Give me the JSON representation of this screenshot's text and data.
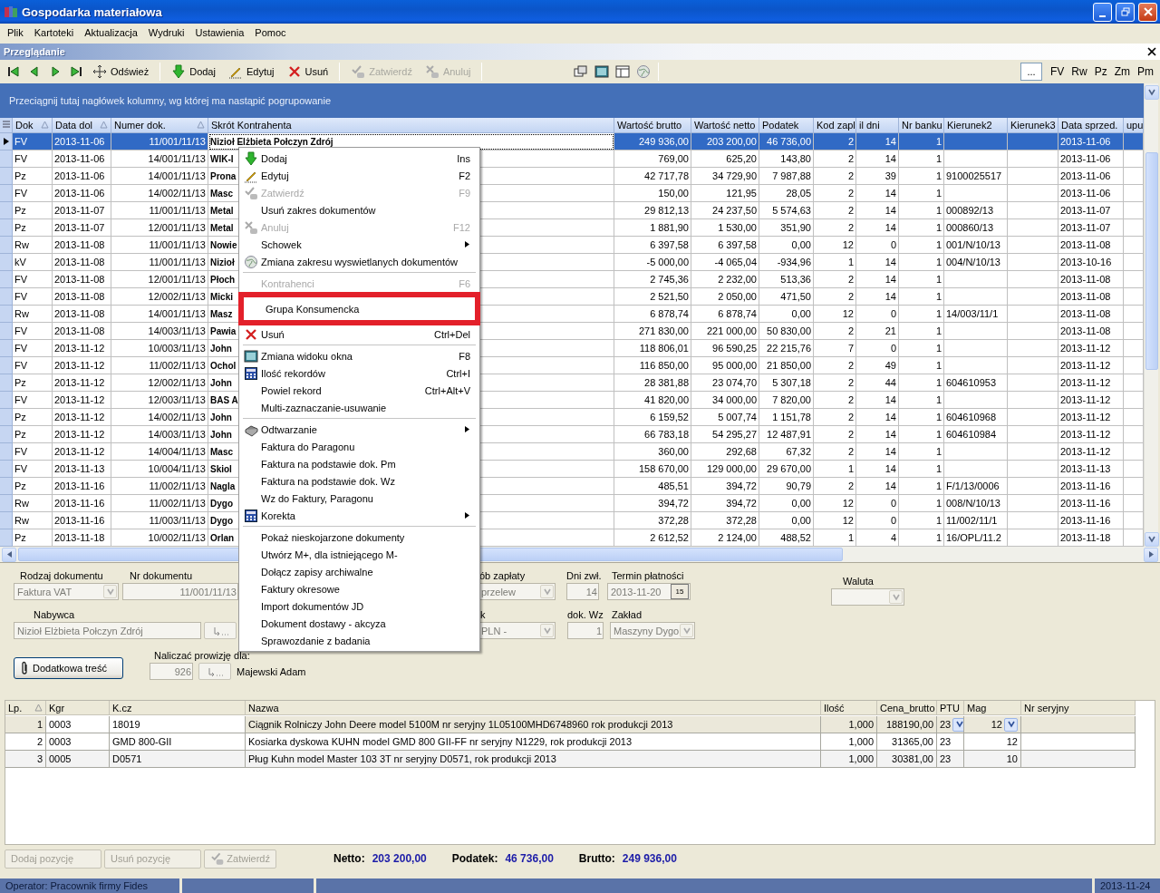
{
  "window": {
    "title": "Gospodarka materiałowa"
  },
  "menu_bar": [
    "Plik",
    "Kartoteki",
    "Aktualizacja",
    "Wydruki",
    "Ustawienia",
    "Pomoc"
  ],
  "panel": {
    "title": "Przeglądanie"
  },
  "toolbar": {
    "buttons": [
      {
        "label": "Odśwież",
        "disabled": false
      },
      {
        "label": "Dodaj",
        "disabled": false
      },
      {
        "label": "Edytuj",
        "disabled": false
      },
      {
        "label": "Usuń",
        "disabled": false
      },
      {
        "label": "Zatwierdź",
        "disabled": true
      },
      {
        "label": "Anuluj",
        "disabled": true
      }
    ],
    "more_button": "...",
    "filters": [
      "FV",
      "Rw",
      "Pz",
      "Zm",
      "Pm"
    ]
  },
  "grid": {
    "group_hint": "Przeciągnij tutaj nagłówek kolumny, wg której ma nastąpić pogrupowanie",
    "columns": [
      {
        "label": "Dok",
        "sorted": true
      },
      {
        "label": "Data dol",
        "sorted": true
      },
      {
        "label": "Numer dok.",
        "sorted": true
      },
      {
        "label": "Skrót Kontrahenta",
        "sorted": false
      },
      {
        "label": "Wartość brutto",
        "sorted": false
      },
      {
        "label": "Wartość netto",
        "sorted": false
      },
      {
        "label": "Podatek",
        "sorted": false
      },
      {
        "label": "Kod zapl",
        "sorted": false
      },
      {
        "label": "il dni",
        "sorted": false
      },
      {
        "label": "Nr banku",
        "sorted": false
      },
      {
        "label": "Kierunek2",
        "sorted": false
      },
      {
        "label": "Kierunek3",
        "sorted": false
      },
      {
        "label": "Data sprzed.",
        "sorted": false
      },
      {
        "label": "upu",
        "sorted": false
      }
    ],
    "rows": [
      {
        "selected": true,
        "cells": [
          "FV",
          "2013-11-06",
          "11/001/11/13",
          "Nizioł Elżbieta Połczyn Zdrój",
          "249 936,00",
          "203 200,00",
          "46 736,00",
          "2",
          "14",
          "1",
          null,
          null,
          "2013-11-06"
        ]
      },
      {
        "selected": false,
        "cells": [
          "FV",
          "2013-11-06",
          "14/001/11/13",
          "WIK-I",
          "769,00",
          "625,20",
          "143,80",
          "2",
          "14",
          "1",
          null,
          null,
          "2013-11-06"
        ]
      },
      {
        "selected": false,
        "cells": [
          "Pz",
          "2013-11-06",
          "14/001/11/13",
          "Prona",
          "42 717,78",
          "34 729,90",
          "7 987,88",
          "2",
          "39",
          "1",
          "9100025517",
          null,
          "2013-11-06"
        ]
      },
      {
        "selected": false,
        "cells": [
          "FV",
          "2013-11-06",
          "14/002/11/13",
          "Masc",
          "150,00",
          "121,95",
          "28,05",
          "2",
          "14",
          "1",
          null,
          null,
          "2013-11-06"
        ]
      },
      {
        "selected": false,
        "cells": [
          "Pz",
          "2013-11-07",
          "11/001/11/13",
          "Metal",
          "29 812,13",
          "24 237,50",
          "5 574,63",
          "2",
          "14",
          "1",
          "000892/13",
          null,
          "2013-11-07"
        ]
      },
      {
        "selected": false,
        "cells": [
          "Pz",
          "2013-11-07",
          "12/001/11/13",
          "Metal",
          "1 881,90",
          "1 530,00",
          "351,90",
          "2",
          "14",
          "1",
          "000860/13",
          null,
          "2013-11-07"
        ]
      },
      {
        "selected": false,
        "cells": [
          "Rw",
          "2013-11-08",
          "11/001/11/13",
          "Nowie",
          "6 397,58",
          "6 397,58",
          "0,00",
          "12",
          "0",
          "1",
          "001/N/10/13",
          null,
          "2013-11-08"
        ]
      },
      {
        "selected": false,
        "cells": [
          "kV",
          "2013-11-08",
          "11/001/11/13",
          "Nizioł",
          "-5 000,00",
          "-4 065,04",
          "-934,96",
          "1",
          "14",
          "1",
          "004/N/10/13",
          null,
          "2013-10-16"
        ]
      },
      {
        "selected": false,
        "cells": [
          "FV",
          "2013-11-08",
          "12/001/11/13",
          "Płoch",
          "2 745,36",
          "2 232,00",
          "513,36",
          "2",
          "14",
          "1",
          null,
          null,
          "2013-11-08"
        ]
      },
      {
        "selected": false,
        "cells": [
          "FV",
          "2013-11-08",
          "12/002/11/13",
          "Micki",
          "2 521,50",
          "2 050,00",
          "471,50",
          "2",
          "14",
          "1",
          null,
          null,
          "2013-11-08"
        ]
      },
      {
        "selected": false,
        "cells": [
          "Rw",
          "2013-11-08",
          "14/001/11/13",
          "Masz",
          "6 878,74",
          "6 878,74",
          "0,00",
          "12",
          "0",
          "1",
          "14/003/11/1",
          null,
          "2013-11-08"
        ]
      },
      {
        "selected": false,
        "cells": [
          "FV",
          "2013-11-08",
          "14/003/11/13",
          "Pawia",
          "271 830,00",
          "221 000,00",
          "50 830,00",
          "2",
          "21",
          "1",
          null,
          null,
          "2013-11-08"
        ]
      },
      {
        "selected": false,
        "cells": [
          "FV",
          "2013-11-12",
          "10/003/11/13",
          "John",
          "118 806,01",
          "96 590,25",
          "22 215,76",
          "7",
          "0",
          "1",
          null,
          null,
          "2013-11-12"
        ]
      },
      {
        "selected": false,
        "cells": [
          "FV",
          "2013-11-12",
          "11/002/11/13",
          "Ochol",
          "116 850,00",
          "95 000,00",
          "21 850,00",
          "2",
          "49",
          "1",
          null,
          null,
          "2013-11-12"
        ]
      },
      {
        "selected": false,
        "cells": [
          "Pz",
          "2013-11-12",
          "12/002/11/13",
          "John",
          "28 381,88",
          "23 074,70",
          "5 307,18",
          "2",
          "44",
          "1",
          "604610953",
          null,
          "2013-11-12"
        ]
      },
      {
        "selected": false,
        "cells": [
          "FV",
          "2013-11-12",
          "12/003/11/13",
          "BAS A",
          "41 820,00",
          "34 000,00",
          "7 820,00",
          "2",
          "14",
          "1",
          null,
          null,
          "2013-11-12"
        ]
      },
      {
        "selected": false,
        "cells": [
          "Pz",
          "2013-11-12",
          "14/002/11/13",
          "John",
          "6 159,52",
          "5 007,74",
          "1 151,78",
          "2",
          "14",
          "1",
          "604610968",
          null,
          "2013-11-12"
        ]
      },
      {
        "selected": false,
        "cells": [
          "Pz",
          "2013-11-12",
          "14/003/11/13",
          "John",
          "66 783,18",
          "54 295,27",
          "12 487,91",
          "2",
          "14",
          "1",
          "604610984",
          null,
          "2013-11-12"
        ]
      },
      {
        "selected": false,
        "cells": [
          "FV",
          "2013-11-12",
          "14/004/11/13",
          "Masc",
          "360,00",
          "292,68",
          "67,32",
          "2",
          "14",
          "1",
          null,
          null,
          "2013-11-12"
        ]
      },
      {
        "selected": false,
        "cells": [
          "FV",
          "2013-11-13",
          "10/004/11/13",
          "Skiol",
          "158 670,00",
          "129 000,00",
          "29 670,00",
          "1",
          "14",
          "1",
          null,
          null,
          "2013-11-13"
        ]
      },
      {
        "selected": false,
        "cells": [
          "Pz",
          "2013-11-16",
          "11/002/11/13",
          "Nagla",
          "485,51",
          "394,72",
          "90,79",
          "2",
          "14",
          "1",
          "F/1/13/0006",
          null,
          "2013-11-16"
        ]
      },
      {
        "selected": false,
        "cells": [
          "Rw",
          "2013-11-16",
          "11/002/11/13",
          "Dygo",
          "394,72",
          "394,72",
          "0,00",
          "12",
          "0",
          "1",
          "008/N/10/13",
          null,
          "2013-11-16"
        ]
      },
      {
        "selected": false,
        "cells": [
          "Rw",
          "2013-11-16",
          "11/003/11/13",
          "Dygo",
          "372,28",
          "372,28",
          "0,00",
          "12",
          "0",
          "1",
          "11/002/11/1",
          null,
          "2013-11-16"
        ]
      },
      {
        "selected": false,
        "cells": [
          "Pz",
          "2013-11-18",
          "10/002/11/13",
          "Orlan",
          "2 612,52",
          "2 124,00",
          "488,52",
          "1",
          "4",
          "1",
          "16/OPL/11.2",
          null,
          "2013-11-18"
        ]
      }
    ]
  },
  "context_menu": {
    "items": [
      {
        "kind": "item",
        "label": "Dodaj",
        "shortcut": "Ins",
        "disabled": false,
        "submenu": false,
        "highlighted": false
      },
      {
        "kind": "item",
        "label": "Edytuj",
        "shortcut": "F2",
        "disabled": false,
        "submenu": false,
        "highlighted": false
      },
      {
        "kind": "item",
        "label": "Zatwierdź",
        "shortcut": "F9",
        "disabled": true,
        "submenu": false,
        "highlighted": false
      },
      {
        "kind": "item",
        "label": "Usuń zakres dokumentów",
        "disabled": false,
        "submenu": false,
        "highlighted": false
      },
      {
        "kind": "item",
        "label": "Anuluj",
        "shortcut": "F12",
        "disabled": true,
        "submenu": false,
        "highlighted": false
      },
      {
        "kind": "item",
        "label": "Schowek",
        "disabled": false,
        "submenu": true,
        "highlighted": false
      },
      {
        "kind": "item",
        "label": "Zmiana zakresu wyswietlanych dokumentów",
        "disabled": false,
        "submenu": false,
        "highlighted": false
      },
      {
        "kind": "separator"
      },
      {
        "kind": "item",
        "label": "Kontrahenci",
        "shortcut": "F6",
        "disabled": true,
        "submenu": false,
        "highlighted": false
      },
      {
        "kind": "item",
        "label": "Grupa Konsumencka",
        "disabled": false,
        "submenu": false,
        "highlighted": true
      },
      {
        "kind": "item",
        "label": "Usuń",
        "shortcut": "Ctrl+Del",
        "disabled": false,
        "submenu": false,
        "highlighted": false
      },
      {
        "kind": "separator"
      },
      {
        "kind": "item",
        "label": "Zmiana widoku okna",
        "shortcut": "F8",
        "disabled": false,
        "submenu": false,
        "highlighted": false
      },
      {
        "kind": "item",
        "label": "Ilość rekordów",
        "shortcut": "Ctrl+I",
        "disabled": false,
        "submenu": false,
        "highlighted": false
      },
      {
        "kind": "item",
        "label": "Powiel rekord",
        "shortcut": "Ctrl+Alt+V",
        "disabled": false,
        "submenu": false,
        "highlighted": false
      },
      {
        "kind": "item",
        "label": "Multi-zaznaczanie-usuwanie",
        "disabled": false,
        "submenu": false,
        "highlighted": false
      },
      {
        "kind": "separator"
      },
      {
        "kind": "item",
        "label": "Odtwarzanie",
        "disabled": false,
        "submenu": true,
        "highlighted": false
      },
      {
        "kind": "item",
        "label": "Faktura do Paragonu",
        "disabled": false,
        "submenu": false,
        "highlighted": false
      },
      {
        "kind": "item",
        "label": "Faktura na podstawie dok. Pm",
        "disabled": false,
        "submenu": false,
        "highlighted": false
      },
      {
        "kind": "item",
        "label": "Faktura na podstawie dok. Wz",
        "disabled": false,
        "submenu": false,
        "highlighted": false
      },
      {
        "kind": "item",
        "label": "Wz do Faktury, Paragonu",
        "disabled": false,
        "submenu": false,
        "highlighted": false
      },
      {
        "kind": "item",
        "label": "Korekta",
        "disabled": false,
        "submenu": true,
        "highlighted": false
      },
      {
        "kind": "separator"
      },
      {
        "kind": "item",
        "label": "Pokaż nieskojarzone dokumenty",
        "disabled": false,
        "submenu": false,
        "highlighted": false
      },
      {
        "kind": "item",
        "label": "Utwórz M+, dla istniejącego M-",
        "disabled": false,
        "submenu": false,
        "highlighted": false
      },
      {
        "kind": "item",
        "label": "Dołącz zapisy archiwalne",
        "disabled": false,
        "submenu": false,
        "highlighted": false
      },
      {
        "kind": "item",
        "label": "Faktury okresowe",
        "disabled": false,
        "submenu": false,
        "highlighted": false
      },
      {
        "kind": "item",
        "label": "Import dokumentów JD",
        "disabled": false,
        "submenu": false,
        "highlighted": false
      },
      {
        "kind": "item",
        "label": "Dokument dostawy - akcyza",
        "disabled": false,
        "submenu": false,
        "highlighted": false
      },
      {
        "kind": "item",
        "label": "Sprawozdanie z badania",
        "disabled": false,
        "submenu": false,
        "highlighted": false
      }
    ]
  },
  "form": {
    "disabled": true,
    "doc_type": {
      "label": "Rodzaj dokumentu",
      "value": "Faktura VAT"
    },
    "doc_number": {
      "label": "Nr dokumentu",
      "value": "11/001/11/13"
    },
    "payment": {
      "label": "ób zapłaty",
      "value": "przelew"
    },
    "delay_days": {
      "label": "Dni zwł.",
      "value": "14"
    },
    "due_date": {
      "label": "Termin płatności",
      "value": "2013-11-20",
      "calendar_button": "15"
    },
    "currency": {
      "label": "Waluta"
    },
    "buyer": {
      "label": "Nabywca",
      "value": "Nizioł Elżbieta Połczyn Zdrój"
    },
    "field_k": {
      "label": "k",
      "value": "PLN -"
    },
    "wz_doc": {
      "label": "dok. Wz",
      "value": "1"
    },
    "plant": {
      "label": "Zakład",
      "value": "Maszyny Dygo"
    },
    "extra_button": "Dodatkowa treść",
    "commission": {
      "label": "Naliczać prowizję dla:",
      "value": "926",
      "person": "Majewski Adam"
    }
  },
  "lines": {
    "columns": [
      {
        "label": "Lp.",
        "sorted": true
      },
      {
        "label": "Kgr",
        "sorted": false
      },
      {
        "label": "K.cz",
        "sorted": false
      },
      {
        "label": "Nazwa",
        "sorted": false
      },
      {
        "label": "Ilość",
        "sorted": false
      },
      {
        "label": "Cena_brutto",
        "sorted": false
      },
      {
        "label": "PTU",
        "sorted": false
      },
      {
        "label": "Mag",
        "sorted": false
      },
      {
        "label": "Nr seryjny",
        "sorted": false
      }
    ],
    "rows": [
      {
        "selected": true,
        "cells": [
          "1",
          "0003",
          "18019",
          "Ciągnik Rolniczy John Deere model 5100M nr seryjny 1L05100MHD6748960 rok produkcji 2013",
          "1,000",
          "188190,00",
          "23",
          "12",
          null
        ]
      },
      {
        "selected": false,
        "cells": [
          "2",
          "0003",
          "GMD 800-GII",
          "Kosiarka dyskowa KUHN model GMD 800 GII-FF nr seryjny N1229, rok produkcji 2013",
          "1,000",
          "31365,00",
          "23",
          "12",
          null
        ]
      },
      {
        "selected": false,
        "cells": [
          "3",
          "0005",
          "D0571",
          "Pług Kuhn model Master 103 3T nr seryjny D0571, rok produkcji 2013",
          "1,000",
          "30381,00",
          "23",
          "10",
          null
        ]
      }
    ]
  },
  "line_buttons": [
    {
      "label": "Dodaj pozycję",
      "disabled": true
    },
    {
      "label": "Usuń pozycję",
      "disabled": true
    },
    {
      "label": "Zatwierdź",
      "disabled": true
    }
  ],
  "totals": [
    {
      "label": "Netto:",
      "value": "203 200,00"
    },
    {
      "label": "Podatek:",
      "value": "46 736,00"
    },
    {
      "label": "Brutto:",
      "value": "249 936,00"
    }
  ],
  "status_bar": {
    "operator": "Operator: Pracownik firmy Fides",
    "date": "2013-11-24"
  }
}
